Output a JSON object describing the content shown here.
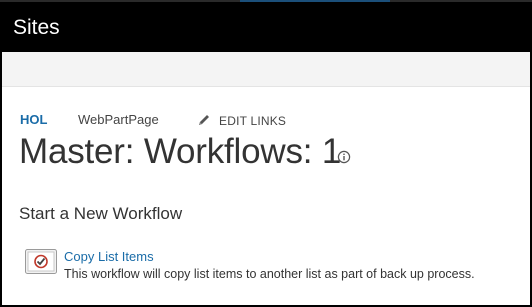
{
  "suite": {
    "title": "Sites"
  },
  "nav": {
    "items": [
      {
        "label": "HOL"
      },
      {
        "label": "WebPartPage"
      }
    ],
    "edit_links": {
      "label": "EDIT LINKS",
      "icon": "pencil-icon"
    }
  },
  "page": {
    "title": "Master: Workflows: 1",
    "info_icon": "info-icon"
  },
  "section": {
    "title": "Start a New Workflow"
  },
  "workflows": [
    {
      "name": "Copy List Items",
      "description": "This workflow will copy list items to another list as part of back up process.",
      "icon": "workflow-icon"
    }
  ],
  "colors": {
    "suite_bar": "#000000",
    "link": "#1a6ca8",
    "text": "#333333",
    "ribbon": "#f4f4f4",
    "workflow_icon_accent": "#c0392b"
  }
}
